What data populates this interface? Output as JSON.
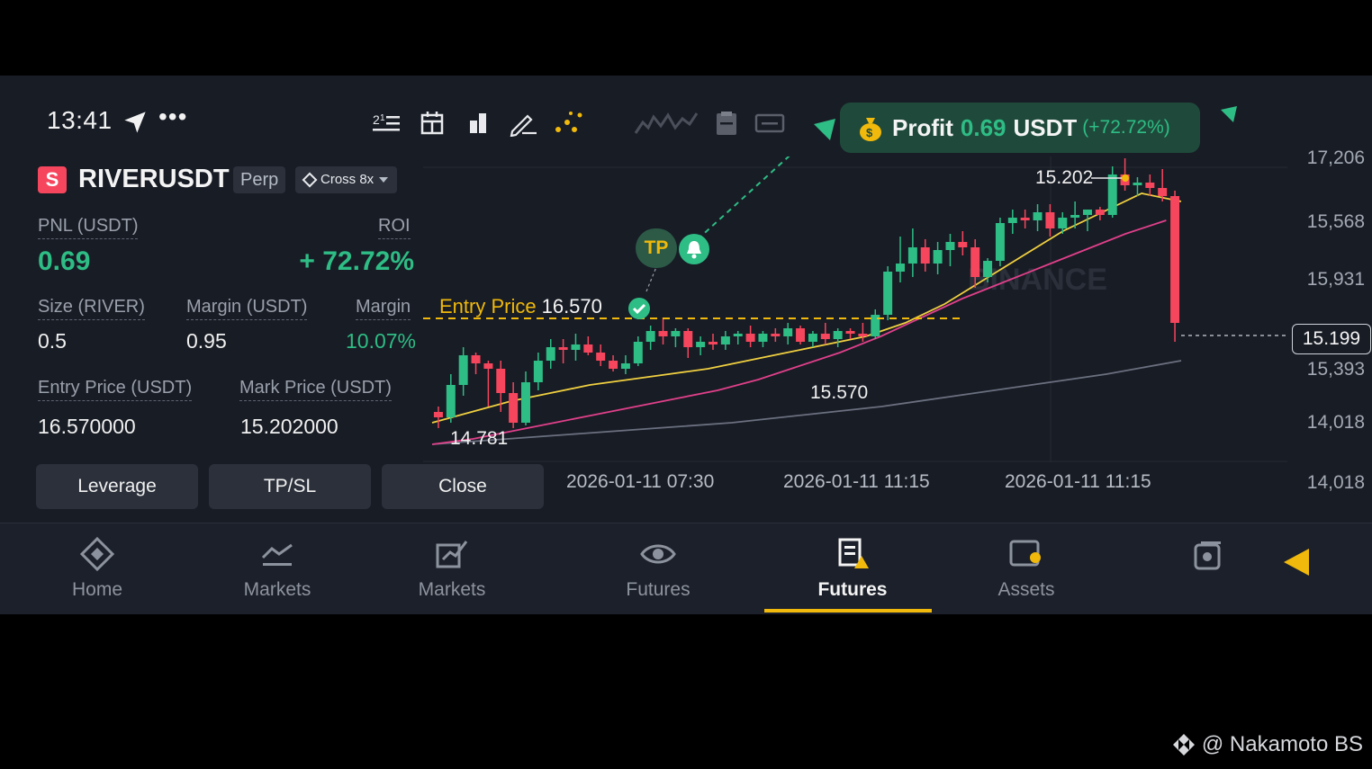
{
  "status": {
    "time": "13:41",
    "more": "•••"
  },
  "toolbar": {
    "icons": [
      "indicator-list-icon",
      "calendar-icon",
      "bar-chart-icon",
      "draw-pen-icon",
      "dots-pattern-icon",
      "sparkline-icon",
      "clipboard-icon",
      "display-icon"
    ]
  },
  "profit_banner": {
    "label": "Profit",
    "value": "0.69",
    "unit": "USDT",
    "percent": "(+72.72%)"
  },
  "symbol": {
    "badge": "S",
    "name": "RIVERUSDT",
    "type": "Perp",
    "mode": "Cross 8x"
  },
  "position": {
    "pnl_label": "PNL (USDT)",
    "pnl_value": "0.69",
    "roi_label": "ROI",
    "roi_value": "+ 72.72%",
    "size_label": "Size (RIVER)",
    "size_value": "0.5",
    "margin_label": "Margin (USDT)",
    "margin_value": "0.95",
    "margin_ratio_label": "Margin",
    "margin_ratio_value": "10.07%",
    "entry_label": "Entry Price (USDT)",
    "entry_value": "16.570000",
    "mark_label": "Mark Price (USDT)",
    "mark_value": "15.202000"
  },
  "buttons": {
    "leverage": "Leverage",
    "tpsl": "TP/SL",
    "close": "Close"
  },
  "chart_data": {
    "type": "candlestick",
    "x_labels": [
      "2026-01-11 07:30",
      "2026-01-11 11:15",
      "2026-01-11 11:15"
    ],
    "y_labels": [
      "17,206",
      "15,568",
      "15,931",
      "15,199",
      "15,393",
      "14,018",
      "14,018"
    ],
    "current_price": "15.199",
    "entry_line": {
      "label": "Entry Price",
      "value": "16.570"
    },
    "tp_label": "TP",
    "annotations": {
      "high": "15.202",
      "mid_low": "15.570",
      "low": "14.781"
    },
    "watermark": "BINANCE",
    "candles": [
      {
        "o": 0.12,
        "h": 0.14,
        "l": 0.06,
        "c": 0.1
      },
      {
        "o": 0.1,
        "h": 0.26,
        "l": 0.08,
        "c": 0.22
      },
      {
        "o": 0.22,
        "h": 0.36,
        "l": 0.18,
        "c": 0.33
      },
      {
        "o": 0.33,
        "h": 0.34,
        "l": 0.26,
        "c": 0.3
      },
      {
        "o": 0.3,
        "h": 0.31,
        "l": 0.14,
        "c": 0.28
      },
      {
        "o": 0.28,
        "h": 0.31,
        "l": 0.12,
        "c": 0.19
      },
      {
        "o": 0.19,
        "h": 0.23,
        "l": 0.06,
        "c": 0.08
      },
      {
        "o": 0.08,
        "h": 0.27,
        "l": 0.07,
        "c": 0.23
      },
      {
        "o": 0.23,
        "h": 0.34,
        "l": 0.2,
        "c": 0.31
      },
      {
        "o": 0.31,
        "h": 0.39,
        "l": 0.28,
        "c": 0.36
      },
      {
        "o": 0.36,
        "h": 0.39,
        "l": 0.3,
        "c": 0.35
      },
      {
        "o": 0.35,
        "h": 0.41,
        "l": 0.31,
        "c": 0.37
      },
      {
        "o": 0.37,
        "h": 0.4,
        "l": 0.33,
        "c": 0.34
      },
      {
        "o": 0.34,
        "h": 0.37,
        "l": 0.29,
        "c": 0.31
      },
      {
        "o": 0.31,
        "h": 0.33,
        "l": 0.27,
        "c": 0.28
      },
      {
        "o": 0.28,
        "h": 0.33,
        "l": 0.26,
        "c": 0.3
      },
      {
        "o": 0.3,
        "h": 0.4,
        "l": 0.29,
        "c": 0.38
      },
      {
        "o": 0.38,
        "h": 0.44,
        "l": 0.35,
        "c": 0.42
      },
      {
        "o": 0.42,
        "h": 0.47,
        "l": 0.37,
        "c": 0.4
      },
      {
        "o": 0.4,
        "h": 0.43,
        "l": 0.36,
        "c": 0.42
      },
      {
        "o": 0.42,
        "h": 0.43,
        "l": 0.32,
        "c": 0.36
      },
      {
        "o": 0.36,
        "h": 0.4,
        "l": 0.33,
        "c": 0.38
      },
      {
        "o": 0.38,
        "h": 0.41,
        "l": 0.35,
        "c": 0.37
      },
      {
        "o": 0.37,
        "h": 0.42,
        "l": 0.35,
        "c": 0.4
      },
      {
        "o": 0.4,
        "h": 0.42,
        "l": 0.37,
        "c": 0.41
      },
      {
        "o": 0.41,
        "h": 0.44,
        "l": 0.36,
        "c": 0.38
      },
      {
        "o": 0.38,
        "h": 0.42,
        "l": 0.36,
        "c": 0.41
      },
      {
        "o": 0.41,
        "h": 0.43,
        "l": 0.38,
        "c": 0.4
      },
      {
        "o": 0.4,
        "h": 0.45,
        "l": 0.37,
        "c": 0.43
      },
      {
        "o": 0.43,
        "h": 0.44,
        "l": 0.37,
        "c": 0.38
      },
      {
        "o": 0.38,
        "h": 0.42,
        "l": 0.36,
        "c": 0.41
      },
      {
        "o": 0.41,
        "h": 0.45,
        "l": 0.37,
        "c": 0.39
      },
      {
        "o": 0.39,
        "h": 0.43,
        "l": 0.36,
        "c": 0.42
      },
      {
        "o": 0.42,
        "h": 0.43,
        "l": 0.39,
        "c": 0.41
      },
      {
        "o": 0.41,
        "h": 0.45,
        "l": 0.38,
        "c": 0.4
      },
      {
        "o": 0.4,
        "h": 0.5,
        "l": 0.39,
        "c": 0.48
      },
      {
        "o": 0.48,
        "h": 0.66,
        "l": 0.46,
        "c": 0.64
      },
      {
        "o": 0.64,
        "h": 0.77,
        "l": 0.6,
        "c": 0.67
      },
      {
        "o": 0.67,
        "h": 0.8,
        "l": 0.62,
        "c": 0.73
      },
      {
        "o": 0.73,
        "h": 0.76,
        "l": 0.64,
        "c": 0.67
      },
      {
        "o": 0.67,
        "h": 0.75,
        "l": 0.63,
        "c": 0.72
      },
      {
        "o": 0.72,
        "h": 0.78,
        "l": 0.66,
        "c": 0.75
      },
      {
        "o": 0.75,
        "h": 0.79,
        "l": 0.7,
        "c": 0.73
      },
      {
        "o": 0.73,
        "h": 0.76,
        "l": 0.58,
        "c": 0.62
      },
      {
        "o": 0.62,
        "h": 0.69,
        "l": 0.6,
        "c": 0.68
      },
      {
        "o": 0.68,
        "h": 0.84,
        "l": 0.66,
        "c": 0.82
      },
      {
        "o": 0.82,
        "h": 0.87,
        "l": 0.78,
        "c": 0.84
      },
      {
        "o": 0.84,
        "h": 0.87,
        "l": 0.8,
        "c": 0.83
      },
      {
        "o": 0.83,
        "h": 0.89,
        "l": 0.79,
        "c": 0.86
      },
      {
        "o": 0.86,
        "h": 0.89,
        "l": 0.77,
        "c": 0.8
      },
      {
        "o": 0.8,
        "h": 0.86,
        "l": 0.78,
        "c": 0.84
      },
      {
        "o": 0.84,
        "h": 0.9,
        "l": 0.8,
        "c": 0.85
      },
      {
        "o": 0.85,
        "h": 0.87,
        "l": 0.79,
        "c": 0.87
      },
      {
        "o": 0.87,
        "h": 0.88,
        "l": 0.83,
        "c": 0.85
      },
      {
        "o": 0.85,
        "h": 1.03,
        "l": 0.84,
        "c": 1.0
      },
      {
        "o": 1.0,
        "h": 1.06,
        "l": 0.94,
        "c": 0.96
      },
      {
        "o": 0.96,
        "h": 0.99,
        "l": 0.92,
        "c": 0.97
      },
      {
        "o": 0.97,
        "h": 1.0,
        "l": 0.92,
        "c": 0.95
      },
      {
        "o": 0.95,
        "h": 1.02,
        "l": 0.9,
        "c": 0.92
      },
      {
        "o": 0.92,
        "h": 0.94,
        "l": 0.38,
        "c": 0.45
      }
    ],
    "ma_yellow": [
      0.08,
      0.12,
      0.16,
      0.19,
      0.22,
      0.24,
      0.26,
      0.28,
      0.31,
      0.34,
      0.37,
      0.4,
      0.45,
      0.52,
      0.61,
      0.7,
      0.79,
      0.86,
      0.93,
      0.9
    ],
    "ma_pink": [
      0.0,
      0.02,
      0.05,
      0.08,
      0.11,
      0.14,
      0.17,
      0.2,
      0.24,
      0.29,
      0.34,
      0.4,
      0.47,
      0.54,
      0.6,
      0.66,
      0.72,
      0.78,
      0.83
    ],
    "ma_gray": [
      0.0,
      0.02,
      0.04,
      0.06,
      0.08,
      0.11,
      0.14,
      0.18,
      0.22,
      0.26,
      0.31
    ]
  },
  "nav": {
    "items": [
      {
        "label": "Home",
        "icon": "home-diamond-icon"
      },
      {
        "label": "Markets",
        "icon": "markets-icon"
      },
      {
        "label": "Markets",
        "icon": "trend-chart-icon"
      },
      {
        "label": "Futures",
        "icon": "eye-icon"
      },
      {
        "label": "Futures",
        "icon": "futures-doc-icon"
      },
      {
        "label": "Assets",
        "icon": "wallet-icon"
      }
    ],
    "active": 4
  },
  "watermark": {
    "text": "@ Nakamoto BS"
  },
  "colors": {
    "up": "#2ebd85",
    "down": "#f6465d",
    "accent": "#f0b90b",
    "bg": "#181c25"
  }
}
